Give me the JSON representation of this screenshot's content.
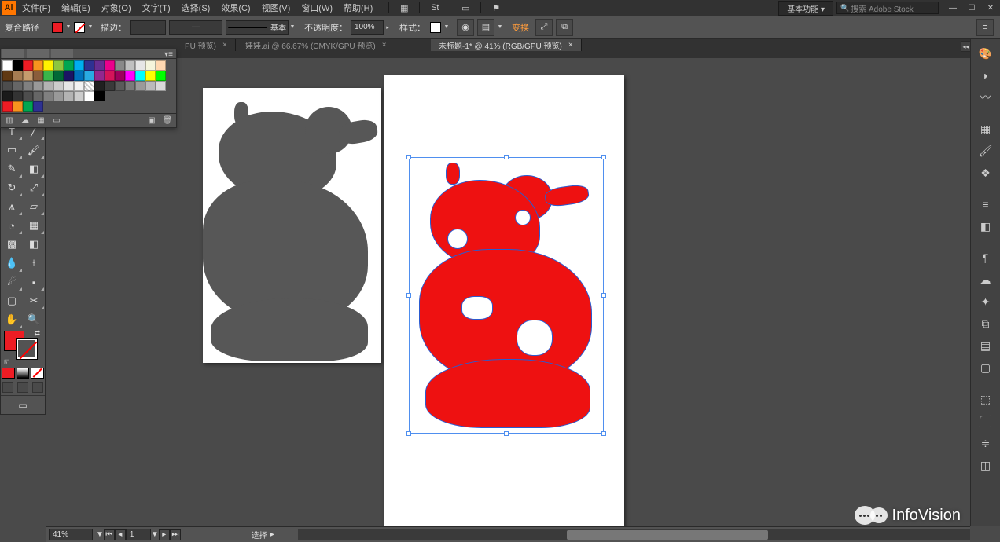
{
  "app": {
    "logo": "Ai"
  },
  "menu": {
    "file": "文件(F)",
    "edit": "编辑(E)",
    "object": "对象(O)",
    "type": "文字(T)",
    "select": "选择(S)",
    "effect": "效果(C)",
    "view": "视图(V)",
    "window": "窗口(W)",
    "help": "帮助(H)"
  },
  "topright": {
    "workspace": "基本功能 ▾",
    "search_placeholder": "搜索 Adobe Stock"
  },
  "control": {
    "selection_label": "复合路径",
    "stroke_label": "描边：",
    "stroke_weight": "",
    "brush_label": "基本",
    "opacity_label": "不透明度：",
    "opacity_value": "100%",
    "style_label": "样式：",
    "transform_link": "变换",
    "fill_color": "#ed1c24",
    "no_stroke": true
  },
  "tabs": [
    {
      "label": "PU 预览)",
      "active": false
    },
    {
      "label": "娃娃.ai @ 66.67% (CMYK/GPU 预览)",
      "active": false
    },
    {
      "label": "未标题-1* @ 41% (RGB/GPU 预览)",
      "active": true
    }
  ],
  "swatches": {
    "rows": [
      [
        "#ffffff",
        "#000000",
        "#ed1c24",
        "#f7931e",
        "#fff200",
        "#8dc63f",
        "#00a651",
        "#00aeef",
        "#2e3192",
        "#662d91",
        "#ec008c",
        "#898989",
        "#c0c0c0",
        "#e6e6e6",
        "#f5f5dc",
        "#ffd8b1"
      ],
      [
        "#603913",
        "#a67c52",
        "#c69c6d",
        "#8a5d3b",
        "#39b54a",
        "#006837",
        "#1b1464",
        "#0071bc",
        "#29abe2",
        "#93278f",
        "#d4145a",
        "#9e005d",
        "#ff00ff",
        "#00ffff",
        "#ffff00",
        "#00ff00"
      ],
      [
        "#4d4d4d",
        "#666666",
        "#808080",
        "#999999",
        "#b3b3b3",
        "#cccccc",
        "#e6e6e6",
        "#f2f2f2",
        "repeating-linear-gradient(45deg,#fff,#fff 2px,#ccc 2px,#ccc 4px)",
        "#202020",
        "#3a3a3a",
        "#5a5a5a",
        "#7a7a7a",
        "#9a9a9a",
        "#bababa",
        "#dadada"
      ],
      [
        "#1a1a1a",
        "#333333",
        "#4d4d4d",
        "#666666",
        "#808080",
        "#999999",
        "#b3b3b3",
        "#cccccc",
        "#ffffff",
        "#000000",
        "",
        "",
        "",
        "",
        "",
        ""
      ],
      [
        "#ed1c24",
        "#f7931e",
        "#00a651",
        "#2e3192",
        "",
        "",
        "",
        "",
        "",
        "",
        "",
        "",
        "",
        "",
        "",
        ""
      ]
    ]
  },
  "toolbox": {
    "fill_color": "#ed1c24"
  },
  "status": {
    "zoom": "41%",
    "artboard_num": "1",
    "status_text": "选择"
  },
  "watermark": {
    "text": "InfoVision"
  },
  "right_icons": [
    "palette-icon",
    "shape-icon",
    "lasso-icon",
    "divider",
    "grid-icon",
    "brush-icon",
    "symbol-icon",
    "divider",
    "menu-icon",
    "swatch-square-icon",
    "divider",
    "text-icon",
    "cloud-icon",
    "star-icon",
    "link-layer-icon",
    "layers-icon",
    "artboard-icon",
    "divider",
    "appearance-icon",
    "select-frame-icon",
    "align-icon",
    "pathfinder-icon"
  ]
}
